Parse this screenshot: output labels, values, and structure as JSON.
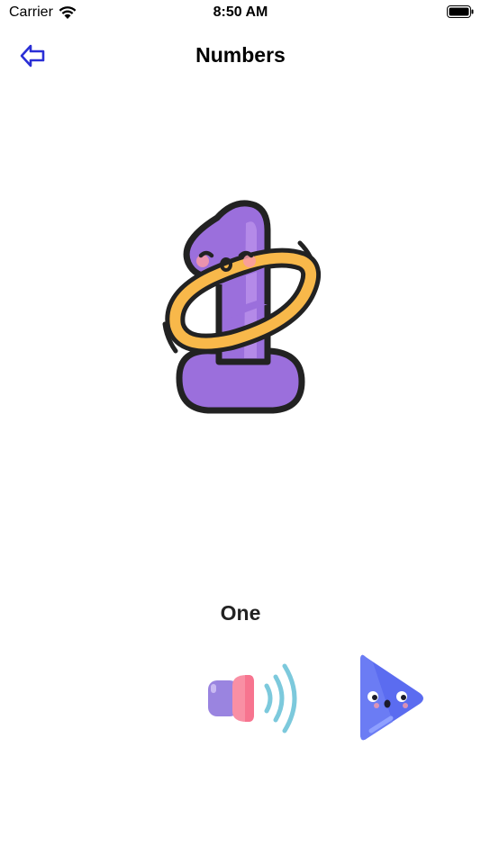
{
  "status_bar": {
    "carrier": "Carrier",
    "time": "8:50 AM",
    "icons": [
      "wifi-icon",
      "battery-icon"
    ]
  },
  "nav": {
    "title": "Numbers",
    "back_icon": "arrow-left-icon",
    "accent_color": "#2a2fd6"
  },
  "card": {
    "illustration": "number-one-character-illustration",
    "word": "One"
  },
  "controls": {
    "speaker_icon": "speaker-icon",
    "play_icon": "play-icon"
  },
  "colors": {
    "purple": "#9b6fdc",
    "orange": "#f8b84a",
    "play_blue": "#5b6cf0",
    "sound_wave": "#7cc9dc",
    "speaker_pink": "#f98fa4"
  }
}
